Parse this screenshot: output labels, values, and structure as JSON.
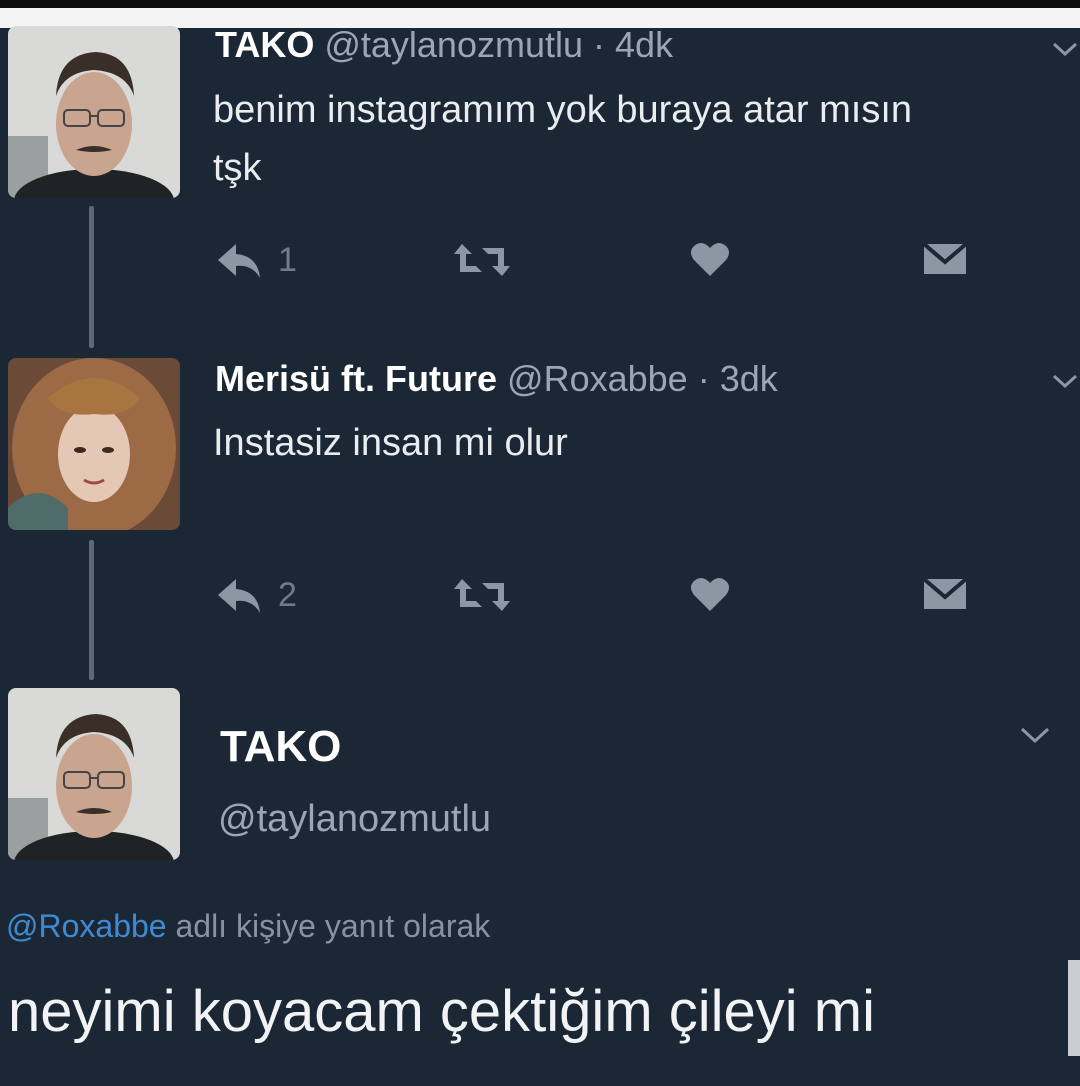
{
  "tweets": [
    {
      "name": "TAKO",
      "handle": "@taylanozmutlu",
      "time": "· 4dk",
      "text_line1": "benim instagramım yok buraya atar mısın",
      "text_line2": "tşk",
      "reply_count": "1"
    },
    {
      "name": "Merisü ft. Future",
      "handle": "@Roxabbe",
      "time": "· 3dk",
      "text_line1": "Instasiz insan mi olur",
      "reply_count": "2"
    }
  ],
  "focused_tweet": {
    "name": "TAKO",
    "handle": "@taylanozmutlu",
    "reply_to_handle": "@Roxabbe",
    "reply_to_suffix": " adlı kişiye yanıt olarak",
    "text": "neyimi koyacam çektiğim çileyi mi"
  },
  "icons": {
    "reply": "reply-icon",
    "retweet": "retweet-icon",
    "like": "heart-icon",
    "dm": "envelope-icon",
    "more": "chevron-down-icon"
  },
  "colors": {
    "background": "#1c2735",
    "icon": "#8b97a3",
    "link": "#3f8ad0"
  }
}
